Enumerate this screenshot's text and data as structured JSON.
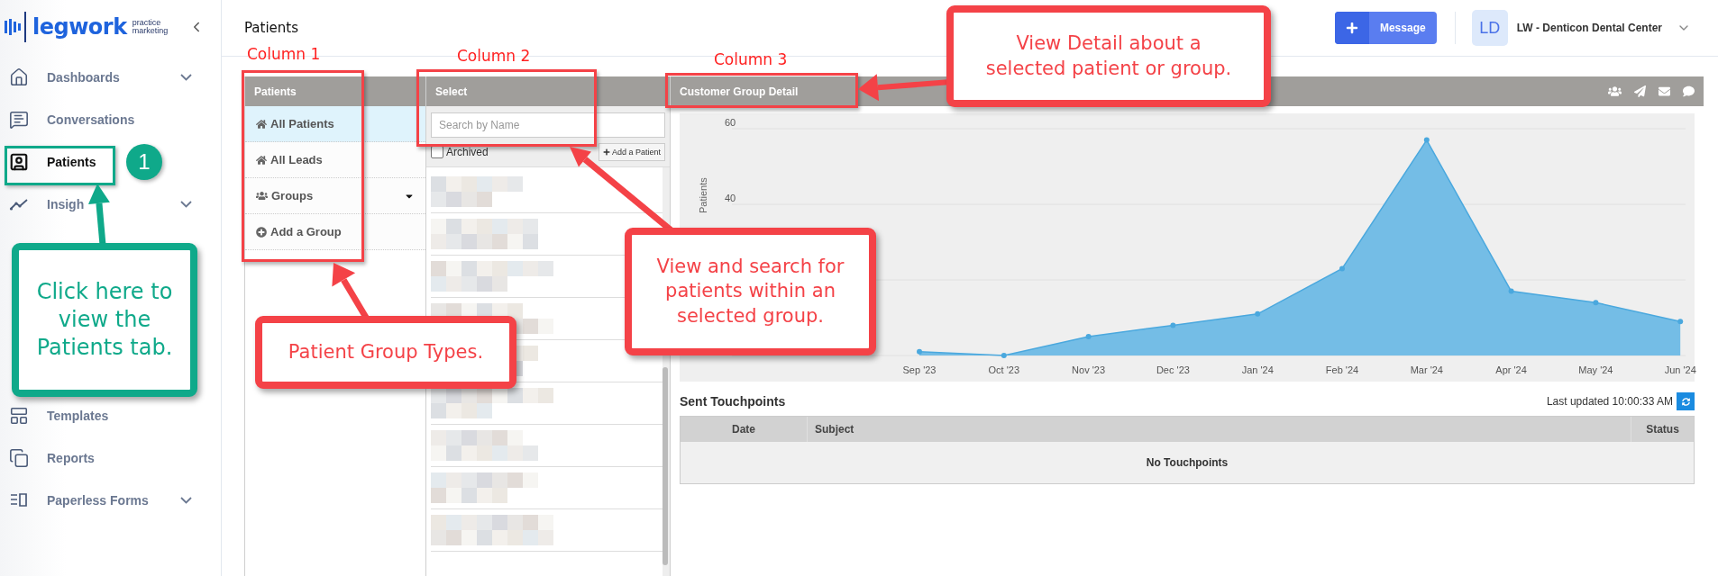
{
  "logo": {
    "name": "legwork",
    "tagline_1": "practice",
    "tagline_2": "marketing"
  },
  "sidebar": {
    "items": [
      {
        "label": "Dashboards",
        "kind": "home",
        "expandable": true,
        "selected": false
      },
      {
        "label": "Conversations",
        "kind": "chat",
        "expandable": false,
        "selected": false
      },
      {
        "label": "Patients",
        "kind": "contact",
        "expandable": false,
        "selected": true
      },
      {
        "label": "Insigh",
        "kind": "trend",
        "expandable": true,
        "selected": false
      },
      {
        "label": "Templates",
        "kind": "template",
        "expandable": false,
        "selected": false
      },
      {
        "label": "Reports",
        "kind": "copy",
        "expandable": false,
        "selected": false
      },
      {
        "label": "Paperless Forms",
        "kind": "forms",
        "expandable": true,
        "selected": false
      }
    ]
  },
  "header": {
    "title": "Patients",
    "message_button": "Message",
    "avatar": "LD",
    "account": "LW - Denticon Dental Center"
  },
  "groups": {
    "title": "Patients",
    "items": [
      {
        "label": "All Patients",
        "kind": "home",
        "selected": true,
        "dropdown": false
      },
      {
        "label": "All Leads",
        "kind": "home",
        "selected": false,
        "dropdown": false
      },
      {
        "label": "Groups",
        "kind": "users",
        "selected": false,
        "dropdown": true
      },
      {
        "label": "Add a Group",
        "kind": "add",
        "selected": false,
        "dropdown": false
      }
    ]
  },
  "select": {
    "title": "Select",
    "search_placeholder": "Search by Name",
    "archived_label": "Archived",
    "archived_checked": false,
    "add_button": "Add a Patient"
  },
  "detail": {
    "title": "Customer Group Detail",
    "chart_data": {
      "type": "area",
      "ylabel": "Patients",
      "categories": [
        "Sep '23",
        "Oct '23",
        "Nov '23",
        "Dec '23",
        "Jan '24",
        "Feb '24",
        "Mar '24",
        "Apr '24",
        "May '24",
        "Jun '24"
      ],
      "series": [
        {
          "color": "#74bde6",
          "values": [
            1,
            0,
            5,
            8,
            11,
            23,
            57,
            17,
            14,
            9
          ]
        }
      ],
      "ylim": [
        0,
        60
      ],
      "yticks": [
        40,
        60
      ]
    },
    "touchpoints": {
      "title": "Sent Touchpoints",
      "last_updated": "Last updated 10:00:33 AM",
      "columns": [
        "Date",
        "Subject",
        "Status"
      ],
      "empty": "No Touchpoints"
    }
  },
  "annotations": {
    "column_labels": [
      "Column 1",
      "Column 2",
      "Column 3"
    ],
    "callouts": [
      {
        "text": "View Detail about a selected patient or group.",
        "color": "#f44247"
      },
      {
        "text": "View and search for patients within an selected group.",
        "color": "#f44247"
      },
      {
        "text": "Patient Group Types.",
        "color": "#f44247"
      },
      {
        "text": "Click here to view the Patients tab.",
        "color": "#0fa98a"
      }
    ],
    "step": "1"
  }
}
